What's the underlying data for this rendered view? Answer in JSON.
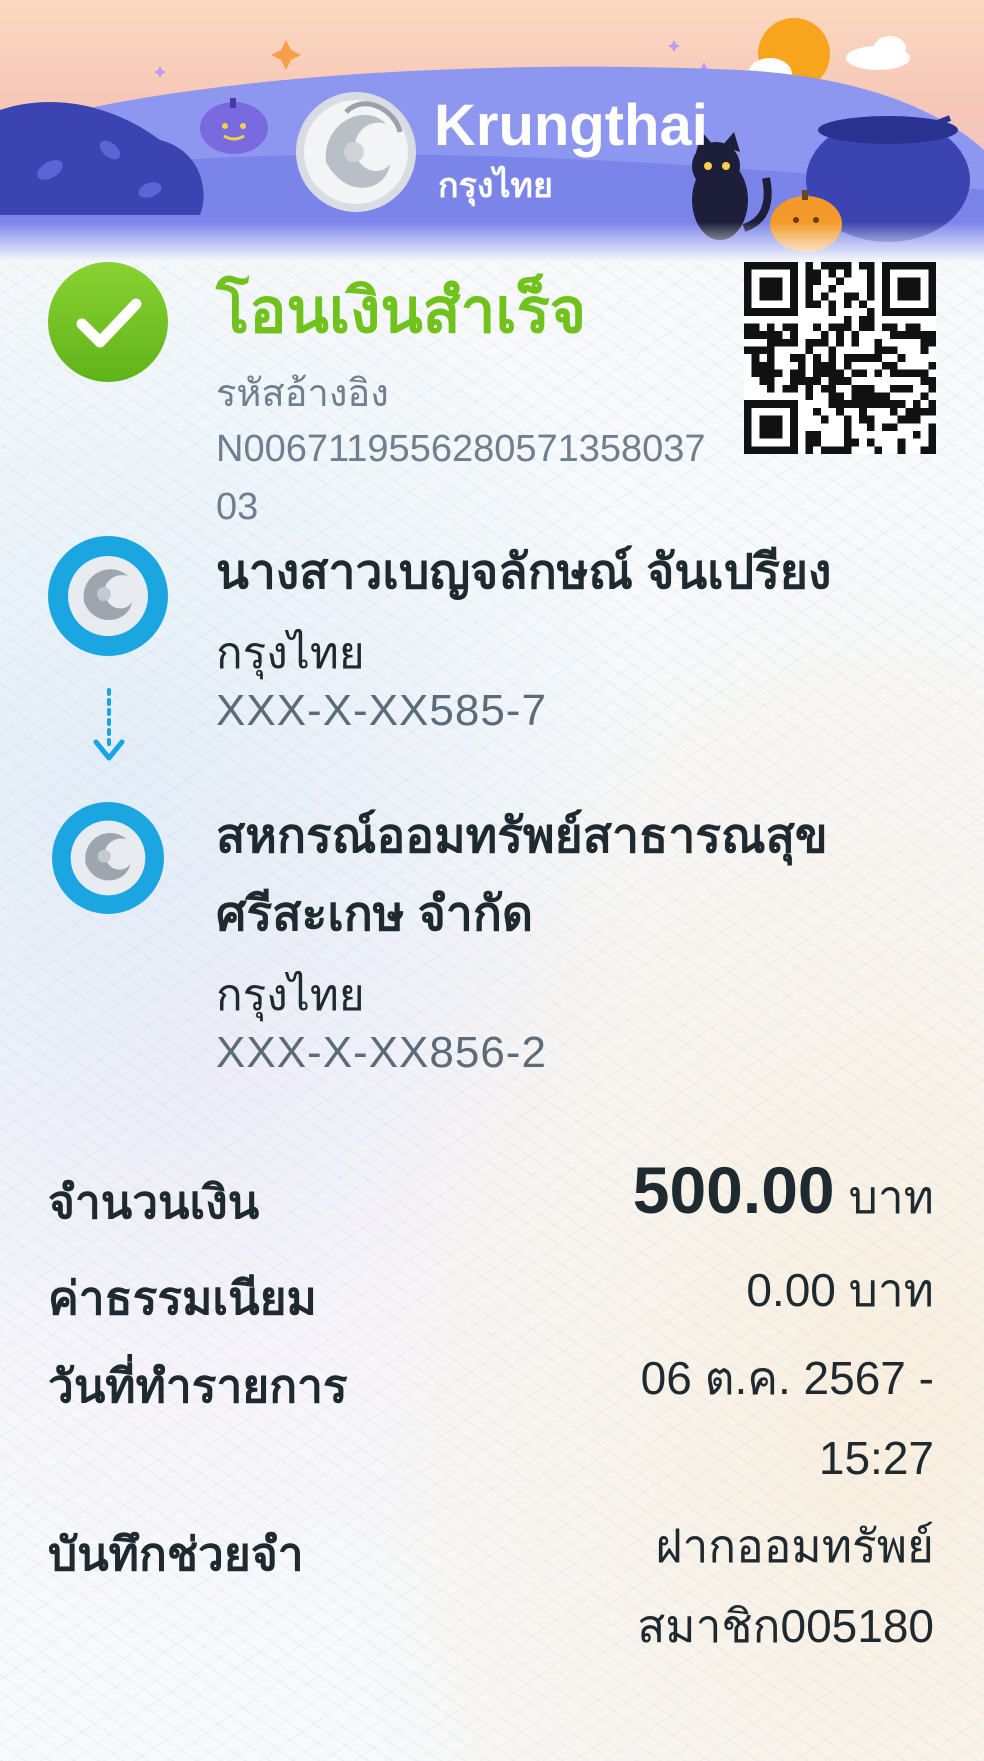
{
  "brand": {
    "name_en": "Krungthai",
    "name_th": "กรุงไทย"
  },
  "status": {
    "title": "โอนเงินสำเร็จ",
    "icon": "check-circle-icon",
    "color": "#71c21d"
  },
  "reference": {
    "label": "รหัสอ้างอิง",
    "number": "N006711955628057135803703"
  },
  "sender": {
    "name": "นางสาวเบญจลักษณ์ จันเปรียง",
    "bank": "กรุงไทย",
    "account": "XXX-X-XX585-7"
  },
  "receiver": {
    "name": "สหกรณ์ออมทรัพย์สาธารณสุขศรีสะเกษ จำกัด",
    "bank": "กรุงไทย",
    "account": "XXX-X-XX856-2"
  },
  "details": {
    "amount_label": "จำนวนเงิน",
    "amount_value": "500.00",
    "amount_unit": "บาท",
    "fee_label": "ค่าธรรมเนียม",
    "fee_value": "0.00 บาท",
    "date_label": "วันที่ทำรายการ",
    "date_value": "06 ต.ค. 2567 - 15:27",
    "memo_label": "บันทึกช่วยจำ",
    "memo_value": "ฝากออมทรัพย์ สมาชิก005180"
  },
  "colors": {
    "brand_blue": "#1ba5e1",
    "success_green": "#71c21d",
    "header_purple": "#7b84e8"
  }
}
